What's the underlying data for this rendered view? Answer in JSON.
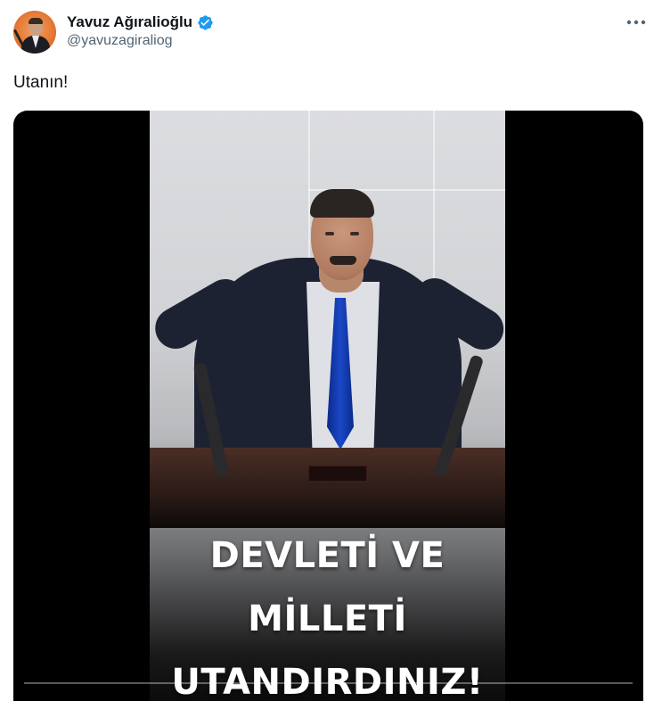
{
  "author": {
    "display_name": "Yavuz Ağıralioğlu",
    "handle": "@yavuzagiraliog",
    "verified": true
  },
  "tweet": {
    "text": "Utanın!"
  },
  "media": {
    "caption_lines": [
      "DEVLETİ VE",
      "MİLLETİ",
      "UTANDIRDINIZ!"
    ]
  },
  "icons": {
    "verified": "verified-badge-icon",
    "more": "more-options-icon"
  },
  "colors": {
    "verified_blue": "#1d9bf0",
    "handle_gray": "#536471",
    "text": "#0f1419",
    "avatar_orange": "#e57a35",
    "tie_blue": "#1b48c7"
  }
}
